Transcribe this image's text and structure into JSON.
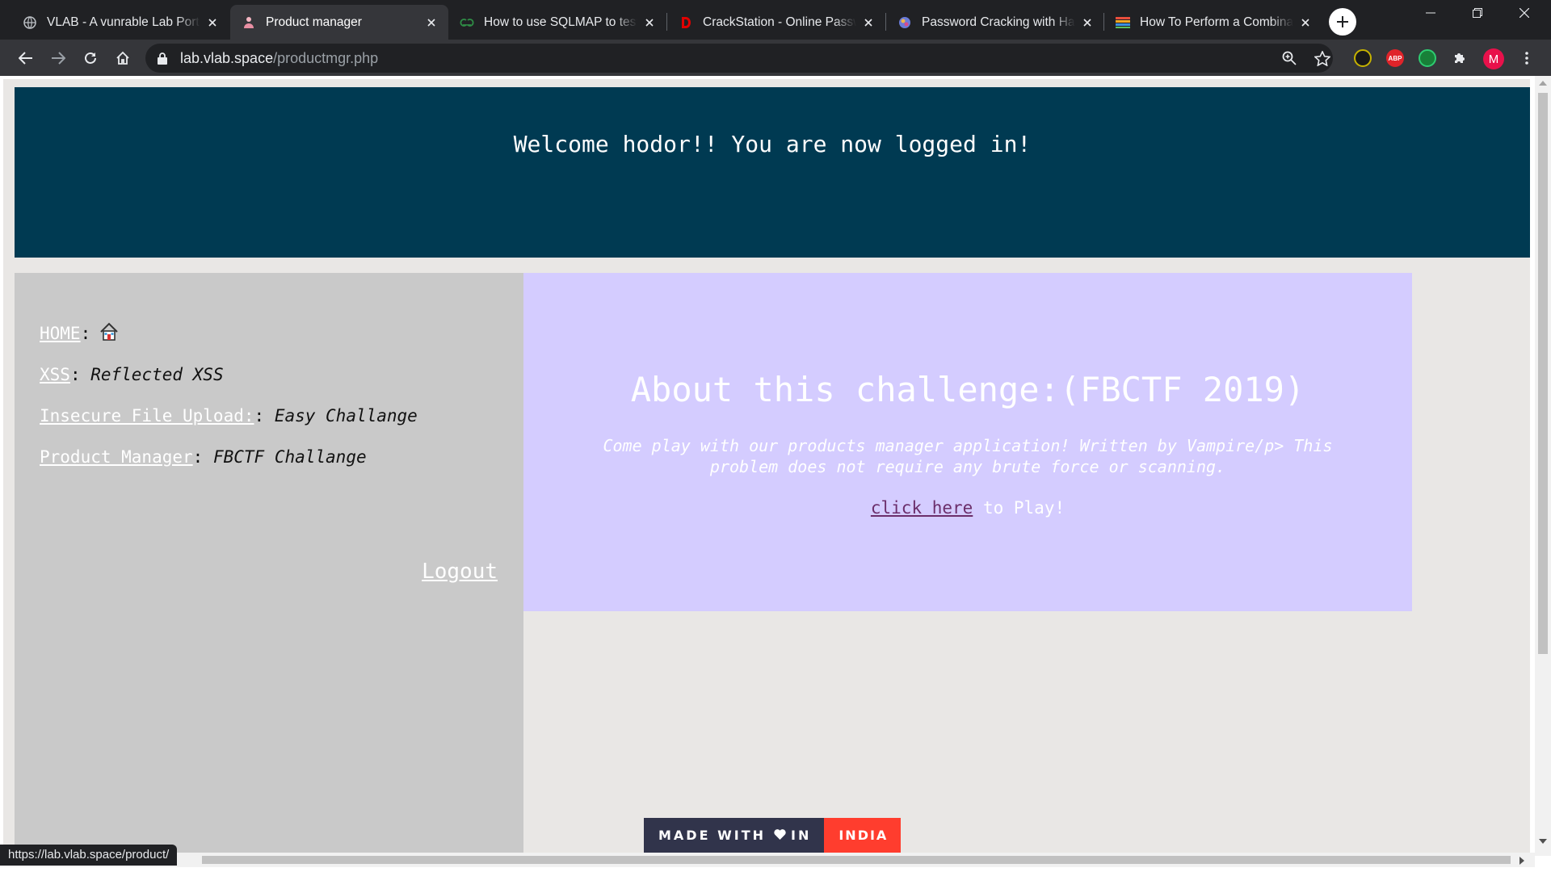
{
  "browser": {
    "tabs": [
      {
        "title": "VLAB - A vunrable Lab Portal",
        "icon": "globe-icon",
        "active": false
      },
      {
        "title": "Product manager",
        "icon": "person-icon",
        "active": true
      },
      {
        "title": "How to use SQLMAP to test a",
        "icon": "geeksforgeeks-icon",
        "active": false
      },
      {
        "title": "CrackStation - Online Password",
        "icon": "crackstation-icon",
        "active": false
      },
      {
        "title": "Password Cracking with Hashc",
        "icon": "site-icon",
        "active": false
      },
      {
        "title": "How To Perform a Combinator",
        "icon": "site-icon",
        "active": false
      }
    ],
    "address": {
      "host": "lab.vlab.space",
      "path": "/productmgr.php"
    },
    "status_url": "https://lab.vlab.space/product/",
    "profile_initial": "M",
    "extensions": [
      "ABP"
    ]
  },
  "page": {
    "welcome": "Welcome hodor!! You are now logged in!",
    "nav": [
      {
        "link": "HOME",
        "sep": ":",
        "desc": ""
      },
      {
        "link": "XSS",
        "sep": ":",
        "desc": " Reflected XSS"
      },
      {
        "link": "Insecure File Upload:",
        "sep": ":",
        "desc": " Easy Challange"
      },
      {
        "link": "Product Manager",
        "sep": ":",
        "desc": " FBCTF Challange"
      }
    ],
    "logout": "Logout",
    "challenge": {
      "title": "About this challenge:(FBCTF 2019)",
      "description": "Come play with our products manager application! Written by Vampire/p> This problem does not require any brute force or scanning.",
      "link": "click here",
      "link_suffix": " to Play!"
    },
    "badge": {
      "left": "MADE WITH",
      "mid": "IN",
      "right": "INDIA"
    }
  },
  "colors": {
    "banner": "#003a52",
    "sidebar": "#c9c9c9",
    "content": "#d4ccff",
    "badge_dark": "#31344b",
    "badge_red": "#ff3d2e"
  }
}
